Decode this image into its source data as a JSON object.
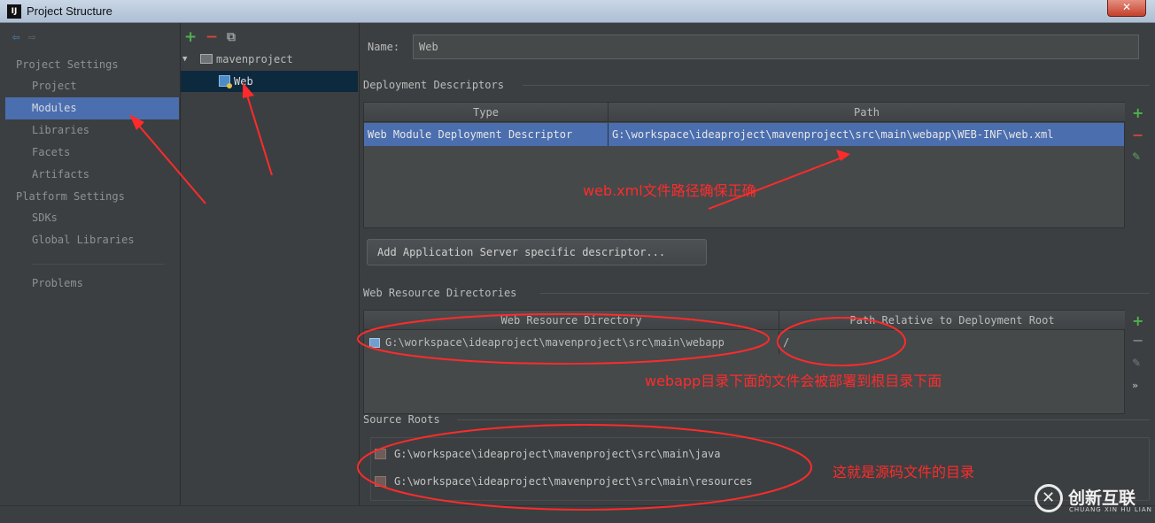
{
  "window": {
    "title": "Project Structure",
    "logo": "IJ",
    "close_label": "✕"
  },
  "sidebar": {
    "project_settings_header": "Project Settings",
    "platform_settings_header": "Platform Settings",
    "items": [
      {
        "label": "Project"
      },
      {
        "label": "Modules"
      },
      {
        "label": "Libraries"
      },
      {
        "label": "Facets"
      },
      {
        "label": "Artifacts"
      },
      {
        "label": "SDKs"
      },
      {
        "label": "Global Libraries"
      },
      {
        "label": "Problems"
      }
    ],
    "selected": "Modules"
  },
  "tree": {
    "root_label": "mavenproject",
    "child_label": "Web"
  },
  "icons": {
    "plus": "+",
    "minus": "−",
    "copy": "⧉",
    "edit": "✎",
    "more": "»",
    "back": "⇦",
    "forward": "⇨",
    "expand": "▼"
  },
  "facet": {
    "name_label": "Name:",
    "name_value": "Web",
    "deployment_descriptors": {
      "title": "Deployment Descriptors",
      "columns": [
        "Type",
        "Path"
      ],
      "rows": [
        {
          "type": "Web Module Deployment Descriptor",
          "path": "G:\\workspace\\ideaproject\\mavenproject\\src\\main\\webapp\\WEB-INF\\web.xml"
        }
      ]
    },
    "add_server_descriptor_button": "Add Application Server specific descriptor...",
    "web_resource_directories": {
      "title": "Web Resource Directories",
      "columns": [
        "Web Resource Directory",
        "Path Relative to Deployment Root"
      ],
      "rows": [
        {
          "directory": "G:\\workspace\\ideaproject\\mavenproject\\src\\main\\webapp",
          "relative_path": "/"
        }
      ]
    },
    "source_roots": {
      "title": "Source Roots",
      "items": [
        "G:\\workspace\\ideaproject\\mavenproject\\src\\main\\java",
        "G:\\workspace\\ideaproject\\mavenproject\\src\\main\\resources"
      ]
    }
  },
  "annotations": {
    "web_xml_note": "web.xml文件路径确保正确",
    "webapp_note": "webapp目录下面的文件会被部署到根目录下面",
    "source_note": "这就是源码文件的目录",
    "color": "#ff2b2b"
  },
  "watermark": {
    "text": "创新互联",
    "subtext": "CHUANG XIN HU LIAN"
  },
  "colors": {
    "selection": "#4b6eaf",
    "background": "#3c3f41",
    "tree_selection": "#0d293e"
  }
}
